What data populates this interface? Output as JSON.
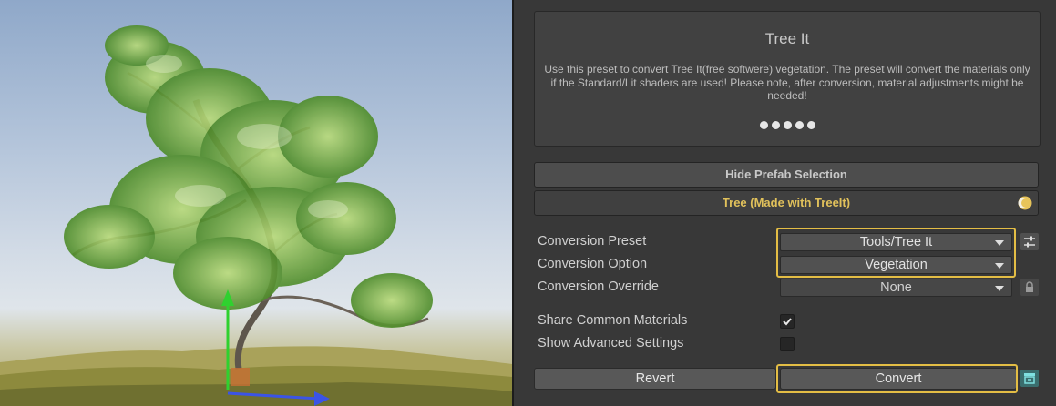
{
  "card": {
    "title": "Tree It",
    "description": "Use this preset to convert Tree It(free softwere) vegetation. The preset will convert the materials only if the Standard/Lit shaders are used! Please note, after conversion, material adjustments might be needed!",
    "rating": 5
  },
  "buttons": {
    "hide_prefab": "Hide Prefab Selection",
    "tree_prefab": "Tree (Made with TreeIt)",
    "revert": "Revert",
    "convert": "Convert"
  },
  "fields": {
    "conversion_preset": {
      "label": "Conversion Preset",
      "value": "Tools/Tree It"
    },
    "conversion_option": {
      "label": "Conversion Option",
      "value": "Vegetation"
    },
    "conversion_override": {
      "label": "Conversion Override",
      "value": "None"
    }
  },
  "toggles": {
    "share_common_materials": {
      "label": "Share Common Materials",
      "checked": true
    },
    "show_advanced_settings": {
      "label": "Show Advanced Settings",
      "checked": false
    }
  },
  "colors": {
    "highlight": "#e3bd45",
    "tree_label": "#e1c15b",
    "panel_bg": "#383838"
  },
  "icons": {
    "preset_settings": "sliders-icon",
    "override_lock": "lock-icon",
    "convert_extra": "archive-icon",
    "tree_status": "moon-circle-icon"
  }
}
